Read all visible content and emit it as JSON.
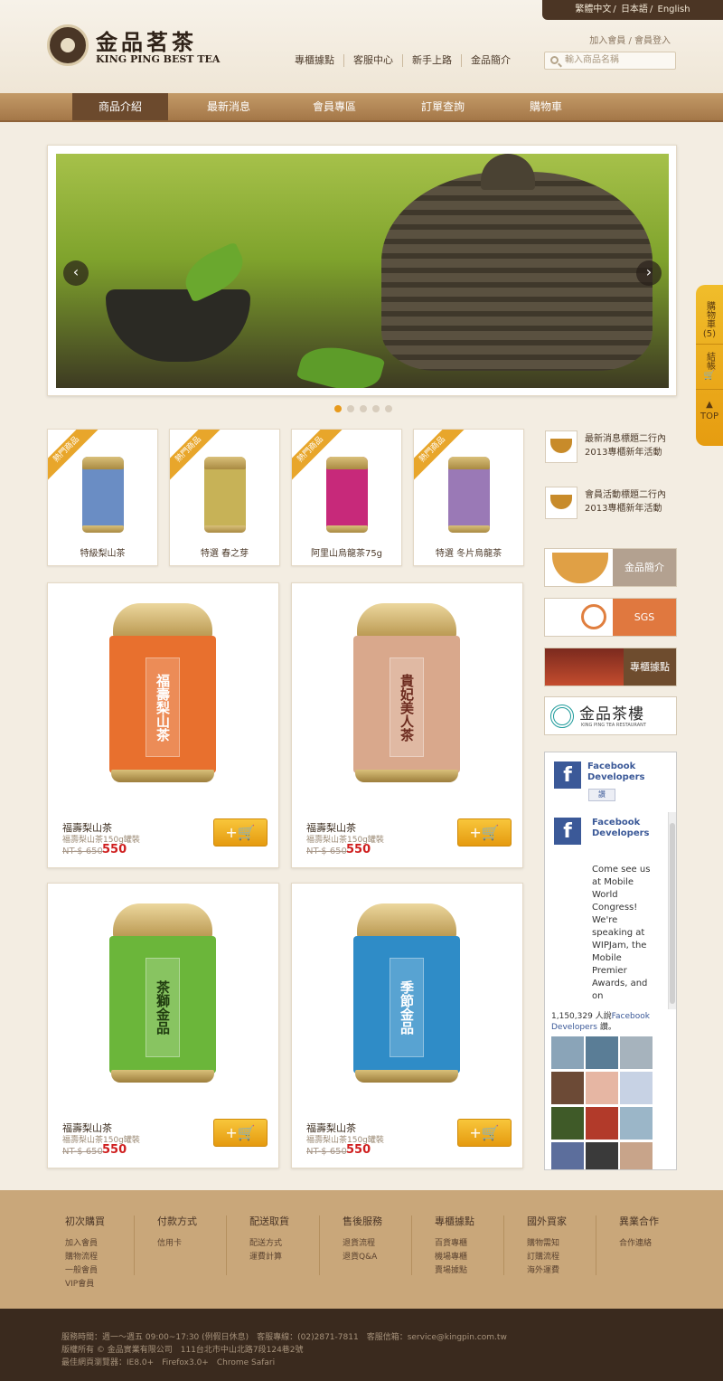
{
  "header": {
    "languages": [
      "繁體中文",
      "日本語",
      "English"
    ],
    "logo_cn": "金品茗茶",
    "logo_en": "KING PING BEST TEA",
    "member_links": [
      "加入會員",
      "會員登入"
    ],
    "top_nav": [
      "專櫃據點",
      "客服中心",
      "新手上路",
      "金品簡介"
    ],
    "search_placeholder": "輸入商品名稱"
  },
  "main_nav": [
    {
      "label": "商品介紹",
      "active": true
    },
    {
      "label": "最新消息",
      "active": false
    },
    {
      "label": "會員專區",
      "active": false
    },
    {
      "label": "訂單查詢",
      "active": false
    },
    {
      "label": "購物車",
      "active": false
    }
  ],
  "banner": {
    "prev_icon": "‹",
    "next_icon": "›",
    "slides": 5,
    "active_slide": 1
  },
  "side_tab": {
    "cart_label": "購物車",
    "cart_count": "(5)",
    "checkout_label": "結帳",
    "top_label": "TOP"
  },
  "hot_label": "熱門商品",
  "small_products": [
    {
      "name": "特級梨山茶",
      "color": "#6a8dc4"
    },
    {
      "name": "特選 春之芽",
      "color": "#c7b257"
    },
    {
      "name": "阿里山烏龍茶75g",
      "color": "#c7297a"
    },
    {
      "name": "特選 冬片烏龍茶",
      "color": "#9a79b6"
    }
  ],
  "big_products": [
    {
      "name": "福壽梨山茶",
      "desc": "福壽梨山茶150g罐裝",
      "old_price": "NT-$ 650",
      "price": "550",
      "color": "#e8702e",
      "label": "福壽梨山茶"
    },
    {
      "name": "福壽梨山茶",
      "desc": "福壽梨山茶150g罐裝",
      "old_price": "NT-$ 650",
      "price": "550",
      "color": "#d9a88c",
      "label": "貴妃美人茶"
    },
    {
      "name": "福壽梨山茶",
      "desc": "福壽梨山茶150g罐裝",
      "old_price": "NT-$ 650",
      "price": "550",
      "color": "#6bb63a",
      "label": "茶獅金品"
    },
    {
      "name": "福壽梨山茶",
      "desc": "福壽梨山茶150g罐裝",
      "old_price": "NT-$ 650",
      "price": "550",
      "color": "#2f8cc7",
      "label": "季節金品"
    }
  ],
  "cart_button_label": "+🛒",
  "news": [
    {
      "text": "最新消息標題二行內 2013專櫃新年活動"
    },
    {
      "text": "會員活動標題二行內 2013專櫃新年活動"
    }
  ],
  "side_banners": [
    {
      "text": "金品簡介",
      "color": "#b3a190"
    },
    {
      "text": "SGS",
      "color": "#e0783f"
    },
    {
      "text": "專櫃據點",
      "color": "#6e4c2e"
    },
    {
      "text": "金品茶樓",
      "sub": "KING PING TEA RESTAURANT",
      "color": "#ffffff"
    }
  ],
  "facebook": {
    "page_name": "Facebook Developers",
    "like_label": "讚",
    "post_author": "Facebook Developers",
    "post_text": "Come see us at Mobile World Congress! We're speaking at WIPJam, the Mobile Premier Awards, and on",
    "count_text": "1,150,329 人說",
    "count_link": "Facebook Developers",
    "count_suffix": " 讚。"
  },
  "footer": {
    "columns": [
      {
        "title": "初次購買",
        "links": [
          "加入會員",
          "購物流程",
          "一般會員",
          "VIP會員"
        ]
      },
      {
        "title": "付款方式",
        "links": [
          "信用卡"
        ]
      },
      {
        "title": "配送取貨",
        "links": [
          "配送方式",
          "運費計算"
        ]
      },
      {
        "title": "售後服務",
        "links": [
          "退貨流程",
          "退貨Q&A"
        ]
      },
      {
        "title": "專櫃據點",
        "links": [
          "百貨專櫃",
          "機場專櫃",
          "賣場據點"
        ]
      },
      {
        "title": "國外買家",
        "links": [
          "購物需知",
          "訂購流程",
          "海外運費"
        ]
      },
      {
        "title": "異業合作",
        "links": [
          "合作連絡"
        ]
      }
    ],
    "service_line": "服務時間：週一～週五 09:00~17:30 (例假日休息)　客服專線：(02)2871-7811　客服信箱：service@kingpin.com.tw",
    "copyright_line": "版權所有 © 金品實業有限公司　111台北市中山北路7段124巷2號",
    "browser_line": "最佳網頁瀏覽器：IE8.0+　Firefox3.0+　Chrome Safari"
  }
}
